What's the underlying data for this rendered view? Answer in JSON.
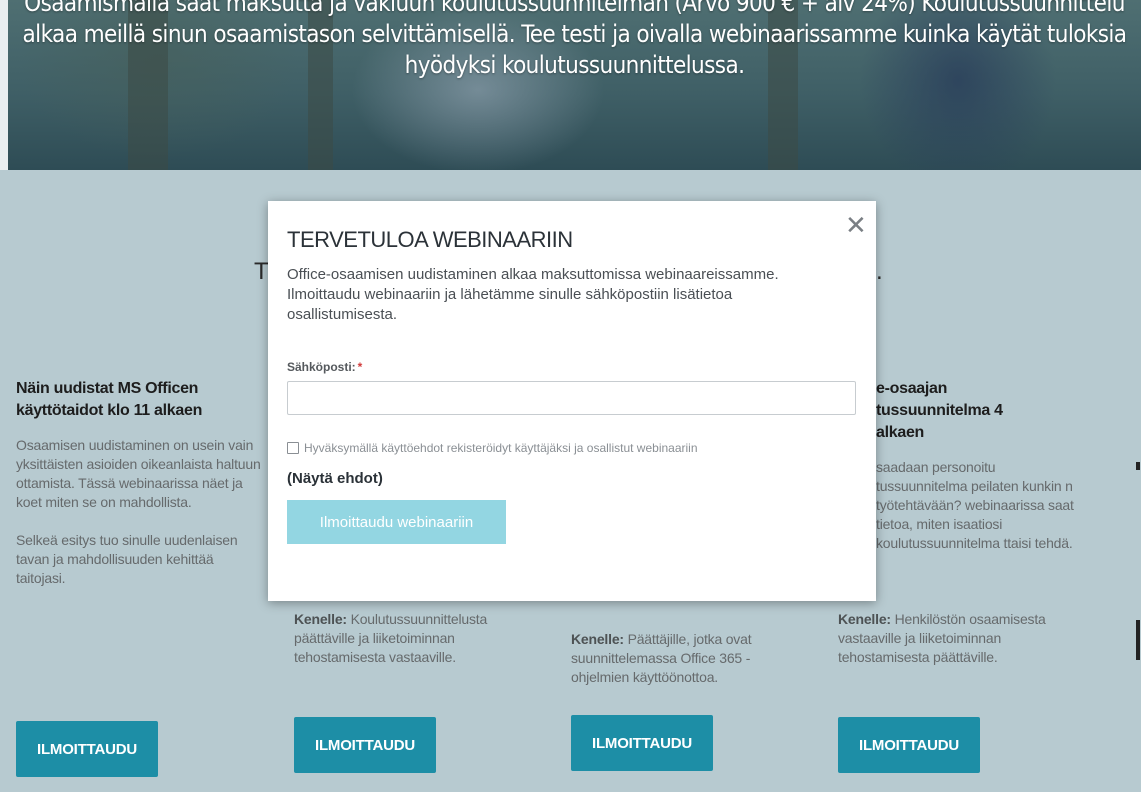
{
  "hero": {
    "text_line1": "Osaamismalla saat maksutta ja vakluun koulutussuunnitelman (Arvo 900 € + alv 24%) Koulutussuunnittelu",
    "text_line2": "alkaa meillä sinun osaamistason selvittämisellä. Tee testi ja oivalla webinaarissamme kuinka käytät tuloksia",
    "text_line3": "hyödyksi koulutussuunnittelussa."
  },
  "section": {
    "title_start": "T",
    "title_end": "."
  },
  "cards": [
    {
      "title": "Näin uudistat MS Officen käyttötaidot klo 11 alkaen",
      "desc1": "Osaamisen uudistaminen on usein vain yksittäisten asioiden oikeanlaista haltuun ottamista. Tässä webinaarissa näet ja koet miten se on mahdollista.",
      "desc2": "Selkeä esitys tuo sinulle uudenlaisen tavan ja mahdollisuuden kehittää taitojasi.",
      "button": "ILMOITTAUDU"
    },
    {
      "for_label": "Kenelle:",
      "for_text": "Koulutussuunnittelusta päättäville ja liiketoiminnan tehostamisesta vastaaville.",
      "button": "ILMOITTAUDU"
    },
    {
      "for_label": "Kenelle:",
      "for_text": "Päättäjille, jotka ovat suunnittelemassa Office 365 -ohjelmien käyttöönottoa.",
      "button": "ILMOITTAUDU"
    },
    {
      "title": "e-osaajan tussuunnitelma 4 alkaen",
      "desc1": "saadaan personoitu tussuunnitelma peilaten kunkin n työtehtävään? webinaarissa saat tietoa, miten isaatiosi koulutussuunnitelma ttaisi tehdä.",
      "for_label": "Kenelle:",
      "for_text": "Henkilöstön osaamisesta vastaaville ja liiketoiminnan tehostamisesta päättäville.",
      "button": "ILMOITTAUDU"
    }
  ],
  "modal": {
    "title": "TERVETULOA WEBINAARIIN",
    "description": "Office-osaamisen uudistaminen alkaa maksuttomissa webinaareissamme. Ilmoittaudu webinaariin ja lähetämme sinulle sähköpostiin lisätietoa osallistumisesta.",
    "email_label": "Sähköposti:",
    "required_mark": "*",
    "email_value": "",
    "checkbox_label": "Hyväksymällä käyttöehdot rekisteröidyt käyttäjäksi ja osallistut webinaariin",
    "show_terms": "(Näytä ehdot)",
    "submit": "Ilmoittaudu webinaariin",
    "close_symbol": "✕"
  },
  "colors": {
    "accent": "#1d8ea6",
    "submit_disabled": "#93d6e2",
    "background": "#b7cad0"
  }
}
